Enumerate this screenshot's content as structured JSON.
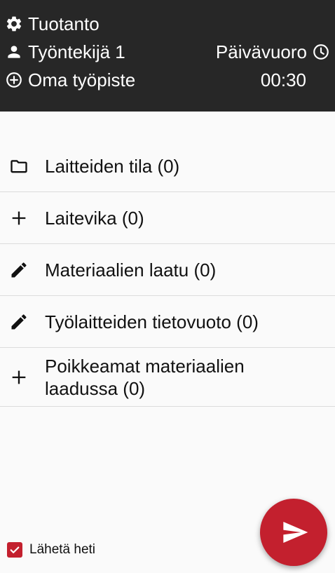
{
  "header": {
    "department": "Tuotanto",
    "department_icon": "gear-icon",
    "worker": "Työntekijä 1",
    "worker_icon": "person-icon",
    "shift": "Päivävuoro",
    "shift_icon": "clock-icon",
    "workstation": "Oma työpiste",
    "workstation_icon": "add-circle-icon",
    "time": "00:30",
    "background": "#272727",
    "text_color": "#ffffff"
  },
  "items": [
    {
      "label": "Laitteiden tila (0)",
      "icon": "folder-icon"
    },
    {
      "label": "Laitevika (0)",
      "icon": "plus-icon"
    },
    {
      "label": "Materiaalien laatu (0)",
      "icon": "pencil-icon"
    },
    {
      "label": "Työlaitteiden tietovuoto (0)",
      "icon": "pencil-icon"
    },
    {
      "label": "Poikkeamat materiaalien laadussa (0)",
      "icon": "plus-icon"
    }
  ],
  "footer": {
    "send_now_label": "Lähetä heti",
    "send_now_checked": true,
    "send_button_icon": "send-icon",
    "accent_color": "#c3202e"
  }
}
